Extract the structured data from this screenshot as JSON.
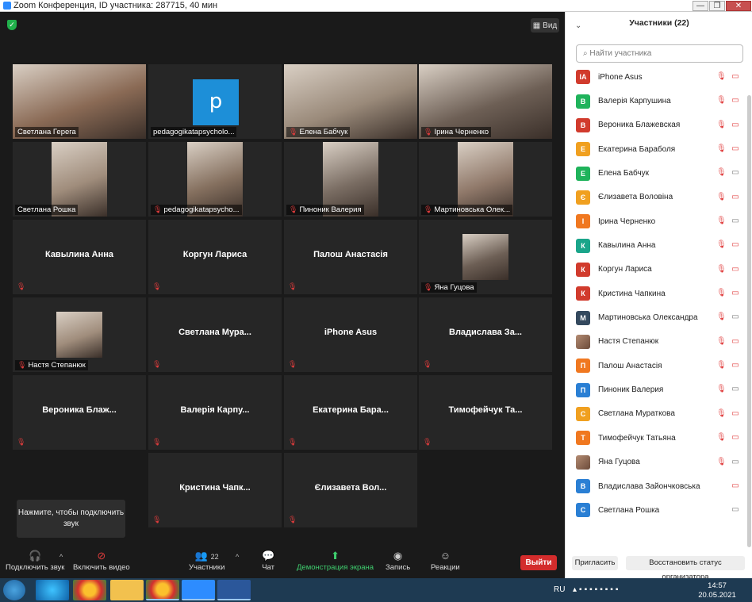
{
  "window": {
    "title": "Zoom Конференция, ID участника: 287715, 40 мин",
    "minimize": "—",
    "restore": "❐",
    "close": "✕"
  },
  "view_button": {
    "label": "Вид"
  },
  "tiles": [
    {
      "label": "Светлана Герега",
      "video": true,
      "active": true,
      "muted": false
    },
    {
      "label": "pedagogikatapsycholo...",
      "logo": "p",
      "muted": false
    },
    {
      "label": "Елена Бабчук",
      "video": true,
      "muted": true
    },
    {
      "label": "Ірина Черненко",
      "video": true,
      "muted": true
    },
    {
      "label": "Светлана Рошка",
      "video": true,
      "muted": false
    },
    {
      "label": "pedagogikatapsycho...",
      "video": true,
      "muted": true
    },
    {
      "label": "Пиноник Валерия",
      "video": true,
      "muted": true
    },
    {
      "label": "Мартиновська Олек...",
      "video": true,
      "muted": true
    },
    {
      "center": "Кавылина Анна",
      "muted": true
    },
    {
      "center": "Коргун Лариса",
      "muted": true
    },
    {
      "center": "Палош Анастасія",
      "muted": true
    },
    {
      "label": "Яна Гуцова",
      "video": true,
      "muted": true
    },
    {
      "label": "Настя Степанюк",
      "video": true,
      "muted": true
    },
    {
      "center": "Светлана Мура...",
      "muted": true
    },
    {
      "center": "iPhone Asus",
      "muted": true
    },
    {
      "center": "Владислава За...",
      "muted": true
    },
    {
      "center": "Вероника Блаж...",
      "muted": true
    },
    {
      "center": "Валерія Карпу...",
      "muted": true
    },
    {
      "center": "Екатерина Бара...",
      "muted": true
    },
    {
      "center": "Тимофейчук Та...",
      "muted": true
    },
    {
      "empty": true
    },
    {
      "center": "Кристина Чапк...",
      "muted": true
    },
    {
      "center": "Єлизавета Вол...",
      "muted": true
    }
  ],
  "tooltip": {
    "text": "Нажмите, чтобы подключить звук"
  },
  "toolbar": {
    "audio": "Подключить звук",
    "video": "Включить видео",
    "participants": "Участники",
    "participants_count": "22",
    "chat": "Чат",
    "share": "Демонстрация экрана",
    "record": "Запись",
    "reactions": "Реакции",
    "leave": "Выйти"
  },
  "panel": {
    "title": "Участники (22)",
    "search_placeholder": "Найти участника",
    "invite": "Пригласить",
    "restore_host": "Восстановить статус организатора",
    "participants": [
      {
        "initials": "IA",
        "name": "iPhone Asus",
        "color": "#d13b2d",
        "mic_muted": true,
        "video_off": true
      },
      {
        "initials": "В",
        "name": "Валерія Карпушина",
        "color": "#1fb35b",
        "mic_muted": true,
        "video_off": true
      },
      {
        "initials": "В",
        "name": "Вероника Блажевская",
        "color": "#d13b2d",
        "mic_muted": true,
        "video_off": true
      },
      {
        "initials": "Е",
        "name": "Екатерина Бараболя",
        "color": "#f0a020",
        "mic_muted": true,
        "video_off": true
      },
      {
        "initials": "Е",
        "name": "Елена Бабчук",
        "color": "#1fb35b",
        "mic_muted": true,
        "video_off": false
      },
      {
        "initials": "Є",
        "name": "Єлизавета Воловіна",
        "color": "#f0a020",
        "mic_muted": true,
        "video_off": true
      },
      {
        "initials": "І",
        "name": "Ірина Черненко",
        "color": "#f07820",
        "mic_muted": true,
        "video_off": false
      },
      {
        "initials": "К",
        "name": "Кавылина Анна",
        "color": "#1aa58a",
        "mic_muted": true,
        "video_off": true
      },
      {
        "initials": "К",
        "name": "Коргун Лариса",
        "color": "#d13b2d",
        "mic_muted": true,
        "video_off": true
      },
      {
        "initials": "К",
        "name": "Кристина Чапкина",
        "color": "#d13b2d",
        "mic_muted": true,
        "video_off": true
      },
      {
        "initials": "М",
        "name": "Мартиновська Олександра",
        "color": "#34495e",
        "mic_muted": true,
        "video_off": false
      },
      {
        "initials": "",
        "name": "Настя Степанюк",
        "photo": true,
        "mic_muted": true,
        "video_off": true
      },
      {
        "initials": "П",
        "name": "Палош Анастасія",
        "color": "#f07820",
        "mic_muted": true,
        "video_off": true
      },
      {
        "initials": "П",
        "name": "Пиноник Валерия",
        "color": "#2a7fd4",
        "mic_muted": true,
        "video_off": false
      },
      {
        "initials": "С",
        "name": "Светлана Мураткова",
        "color": "#f0a020",
        "mic_muted": true,
        "video_off": true
      },
      {
        "initials": "Т",
        "name": "Тимофейчук Татьяна",
        "color": "#f07820",
        "mic_muted": true,
        "video_off": true
      },
      {
        "initials": "",
        "name": "Яна Гуцова",
        "photo": true,
        "mic_muted": true,
        "video_off": false
      },
      {
        "initials": "В",
        "name": "Владислава Зайончковська",
        "color": "#2a7fd4",
        "mic_muted": false,
        "video_off": true
      },
      {
        "initials": "С",
        "name": "Светлана Рошка",
        "color": "#2a7fd4",
        "mic_muted": false,
        "video_off": false
      }
    ]
  },
  "taskbar": {
    "lang": "RU",
    "time": "14:57",
    "date": "20.05.2021",
    "apps": [
      "windows-start",
      "edge",
      "chrome",
      "file-explorer",
      "chrome-window",
      "zoom",
      "word"
    ]
  }
}
